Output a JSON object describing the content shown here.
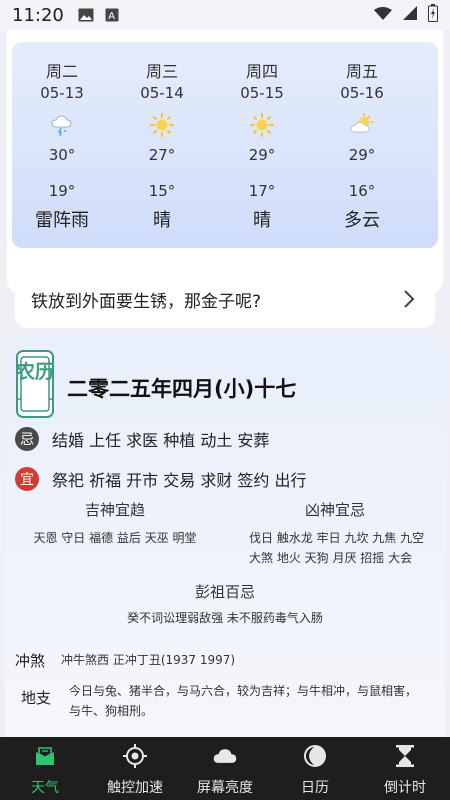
{
  "status_bar": {
    "time": "11:20"
  },
  "weather": {
    "forecast": [
      {
        "weekday": "周二",
        "date": "05-13",
        "icon": "thunderstorm-icon",
        "high": "30°",
        "low": "19°",
        "condition": "雷阵雨"
      },
      {
        "weekday": "周三",
        "date": "05-14",
        "icon": "sunny-icon",
        "high": "27°",
        "low": "15°",
        "condition": "晴"
      },
      {
        "weekday": "周四",
        "date": "05-15",
        "icon": "sunny-icon",
        "high": "29°",
        "low": "17°",
        "condition": "晴"
      },
      {
        "weekday": "周五",
        "date": "05-16",
        "icon": "partly-cloudy-icon",
        "high": "29°",
        "low": "16°",
        "condition": "多云"
      }
    ]
  },
  "question": {
    "text": "铁放到外面要生锈，那金子呢?"
  },
  "almanac": {
    "seal_text": "农历",
    "lunar_date": "二零二五年四月(小)十七",
    "avoid_badge": "忌",
    "avoid_items": "结婚 上任 求医 种植 动土 安葬",
    "suitable_badge": "宜",
    "suitable_items": "祭祀 祈福 开市 交易 求财 签约 出行",
    "lucky_gods_title": "吉神宜趋",
    "lucky_gods": "天恩 守日 福德 益后 天巫 明堂",
    "evil_spirits_title": "凶神宜忌",
    "evil_spirits": "伐日 触水龙 牢日 九坎 九焦 九空 大煞 地火 天狗 月厌 招摇 大会",
    "pengzu_title": "彭祖百忌",
    "pengzu": "癸不词讼理弱敌强 未不服药毒气入肠",
    "clash_label": "冲煞",
    "clash_value": "冲牛煞西 正冲丁丑(1937 1997)",
    "dizhi_label": "地支",
    "dizhi_value": "今日与兔、猪半合，与马六合，较为吉祥；与牛相冲，与鼠相害，与牛、狗相刑。"
  },
  "bottom_nav": [
    {
      "label": "天气",
      "icon": "weather-icon",
      "active": true
    },
    {
      "label": "触控加速",
      "icon": "target-icon",
      "active": false
    },
    {
      "label": "屏幕亮度",
      "icon": "cloud-icon",
      "active": false
    },
    {
      "label": "日历",
      "icon": "moon-phase-icon",
      "active": false
    },
    {
      "label": "倒计时",
      "icon": "hourglass-icon",
      "active": false
    }
  ],
  "colors": {
    "active_nav": "#2fc46d",
    "suitable_badge": "#d23b33",
    "avoid_badge": "#4a4a4a",
    "seal_green": "#3d9a7e"
  }
}
